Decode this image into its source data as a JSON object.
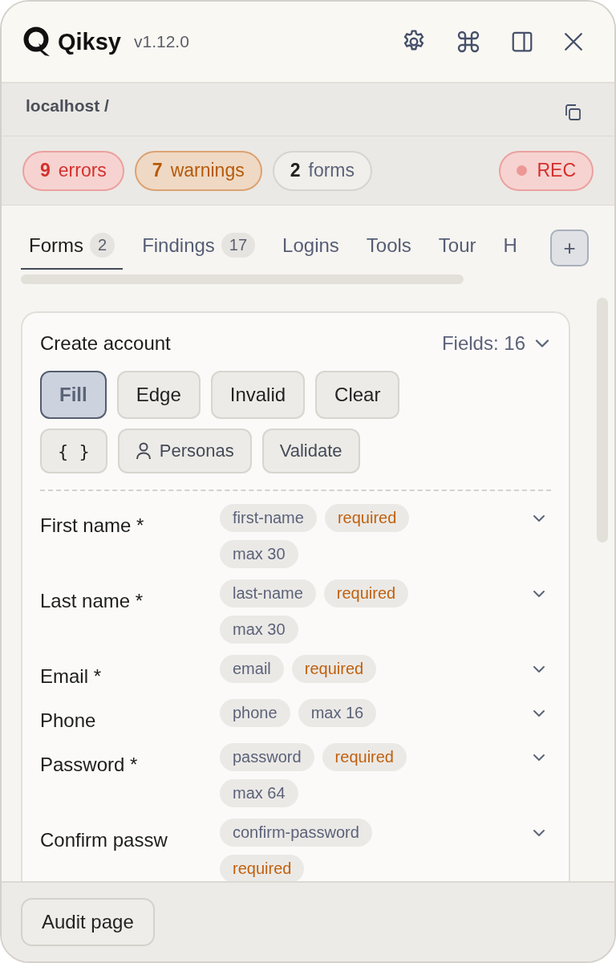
{
  "header": {
    "brand": "Qiksy",
    "version": "v1.12.0"
  },
  "location": {
    "path": "localhost /"
  },
  "summary": [
    {
      "kind": "error",
      "count": "9",
      "label": "errors"
    },
    {
      "kind": "warning",
      "count": "7",
      "label": "warnings"
    },
    {
      "kind": "neutral",
      "count": "2",
      "label": "forms"
    }
  ],
  "recorder": {
    "label": "REC",
    "recording": false
  },
  "tabs": [
    {
      "label": "Forms",
      "count": "2",
      "selected": true
    },
    {
      "label": "Findings",
      "count": "17",
      "selected": false
    },
    {
      "label": "Logins",
      "selected": false
    },
    {
      "label": "Tools",
      "selected": false
    },
    {
      "label": "Tour",
      "selected": false
    },
    {
      "label": "H",
      "selected": false
    }
  ],
  "add_tab": {
    "label": "+"
  },
  "form_card": {
    "title": "Create account",
    "field_count": "Fields: 16",
    "actions": [
      {
        "label": "Fill",
        "selected": true
      },
      {
        "label": "Edge",
        "selected": false
      },
      {
        "label": "Invalid",
        "selected": false
      },
      {
        "label": "Clear",
        "selected": false
      }
    ],
    "tools": [
      {
        "kind": "json",
        "label": "{ }"
      },
      {
        "kind": "personas",
        "label": "Personas"
      },
      {
        "kind": "plain",
        "label": "Validate"
      }
    ],
    "fields": [
      {
        "label": "First name *",
        "tags": [
          {
            "kind": "id",
            "text": "first-name"
          },
          {
            "kind": "required",
            "text": "required"
          },
          {
            "kind": "limit",
            "text": "max 30"
          }
        ]
      },
      {
        "label": "Last name *",
        "tags": [
          {
            "kind": "id",
            "text": "last-name"
          },
          {
            "kind": "required",
            "text": "required"
          },
          {
            "kind": "limit",
            "text": "max 30"
          }
        ]
      },
      {
        "label": "Email *",
        "tags": [
          {
            "kind": "id",
            "text": "email"
          },
          {
            "kind": "required",
            "text": "required"
          }
        ]
      },
      {
        "label": "Phone",
        "tags": [
          {
            "kind": "id",
            "text": "phone"
          },
          {
            "kind": "limit",
            "text": "max 16"
          }
        ]
      },
      {
        "label": "Password *",
        "tags": [
          {
            "kind": "id",
            "text": "password"
          },
          {
            "kind": "required",
            "text": "required"
          },
          {
            "kind": "limit",
            "text": "max 64"
          }
        ]
      },
      {
        "label": "Confirm passw",
        "tags": [
          {
            "kind": "id",
            "text": "confirm-password"
          },
          {
            "kind": "required",
            "text": "required"
          }
        ]
      }
    ]
  },
  "footer": {
    "button": "Audit page"
  }
}
